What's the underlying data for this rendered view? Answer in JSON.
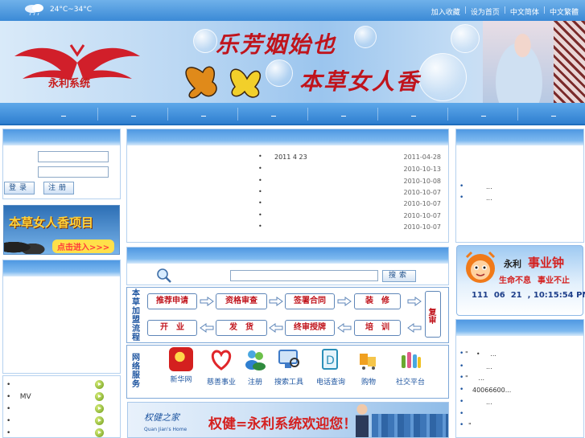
{
  "topbar": {
    "weather_icon": "cloud-rain-icon",
    "temperature": "24°C~34°C",
    "links": [
      "加入收藏",
      "设为首页",
      "中文简体",
      "中文繁體"
    ],
    "separator": "|"
  },
  "banner": {
    "logo_text": "永利系统",
    "slogan_line1": "乐芳姻始也",
    "slogan_line2": "本草女人香"
  },
  "login": {
    "login_button": "登录",
    "register_button": "注册"
  },
  "promo": {
    "title": "本草女人香项目",
    "enter": "点击进入>>>"
  },
  "left_list": {
    "items": [
      {
        "dot": "•",
        "label": ""
      },
      {
        "dot": "•",
        "label": "MV"
      },
      {
        "dot": "•",
        "label": ""
      },
      {
        "dot": "•",
        "label": ""
      },
      {
        "dot": "•",
        "label": ""
      }
    ]
  },
  "news": {
    "items": [
      {
        "dot": "•",
        "title": "2011 4 23",
        "date": "2011-04-28"
      },
      {
        "dot": "•",
        "title": "",
        "date": "2010-10-13"
      },
      {
        "dot": "•",
        "title": "",
        "date": "2010-10-08"
      },
      {
        "dot": "•",
        "title": "",
        "date": "2010-10-07"
      },
      {
        "dot": "•",
        "title": "",
        "date": "2010-10-07"
      },
      {
        "dot": "•",
        "title": "",
        "date": "2010-10-07"
      },
      {
        "dot": "•",
        "title": "",
        "date": "2010-10-07"
      }
    ]
  },
  "search": {
    "button": "搜索",
    "icon": "magnifier-icon"
  },
  "flow": {
    "label": "本草加盟流程",
    "row1": [
      "推荐申请",
      "资格审查",
      "签署合同",
      "装　修"
    ],
    "row2": [
      "开　业",
      "发　货",
      "终审授牌",
      "培　训"
    ],
    "side": "复审"
  },
  "services": {
    "label": "网络服务",
    "items": [
      {
        "label": "新华网",
        "icon": "xinhua-icon",
        "color": "#d4201f"
      },
      {
        "label": "慈善事业",
        "icon": "heart-icon",
        "color": "#e0262a"
      },
      {
        "label": "注册",
        "icon": "users-icon",
        "color": "#2f8b3e"
      },
      {
        "label": "搜索工具",
        "icon": "computer-search-icon",
        "color": "#3e7ac7"
      },
      {
        "label": "电话查询",
        "icon": "phone-book-icon",
        "color": "#2b8fb8"
      },
      {
        "label": "购物",
        "icon": "shopping-icon",
        "color": "#f0a020"
      },
      {
        "label": "社交平台",
        "icon": "bottles-icon",
        "color": "#6aa830"
      }
    ]
  },
  "bottom_banner": {
    "brand": "权健之家",
    "brand_en": "Quan Jian's Home",
    "slogan": "权健=永利系统欢迎您！"
  },
  "right_top": {
    "items": [
      {
        "dot": "•",
        "text": "..."
      },
      {
        "dot": "•",
        "text": "..."
      }
    ]
  },
  "clock": {
    "brand": "永利",
    "title": "事业钟",
    "motto1": "生命不息",
    "motto2": "事业不止",
    "datetime": "111  06  21  , 10:15:54 PM"
  },
  "right_bottom": {
    "items": [
      {
        "dot": "•",
        "text": "\"    •     ..."
      },
      {
        "dot": "•",
        "text": "..."
      },
      {
        "dot": "•",
        "text": "\"     ..."
      },
      {
        "dot": "•",
        "text": "40066600..."
      },
      {
        "dot": "•",
        "text": "..."
      },
      {
        "dot": "•",
        "text": ""
      },
      {
        "dot": "•",
        "text": "\""
      }
    ]
  },
  "colors": {
    "topbar": "#3b8ad6",
    "nav": "#2f7fd0",
    "accent_red": "#c0141c",
    "link_blue": "#1e55a0"
  }
}
